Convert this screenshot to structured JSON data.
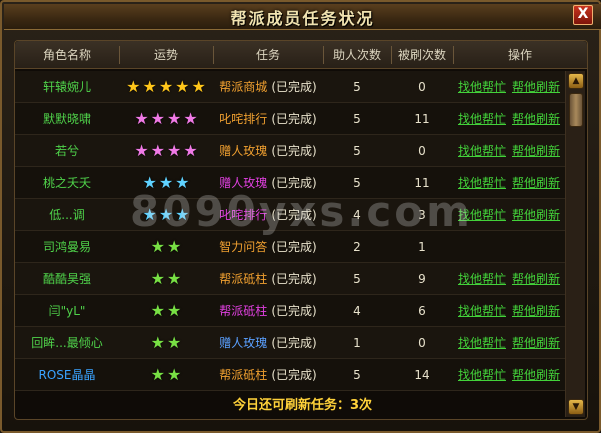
{
  "window": {
    "title": "帮派成员任务状况",
    "close_label": "X"
  },
  "table": {
    "headers": [
      "角色名称",
      "运势",
      "任务",
      "助人次数",
      "被刷次数",
      "操作"
    ],
    "rows": [
      {
        "name": "轩辕婉儿",
        "name_color": "green",
        "stars": 5,
        "star_color": "gold",
        "task": "帮派商城",
        "task_color": "#f0a030",
        "status": "(已完成)",
        "helped": "5",
        "refreshed": "0",
        "actions": [
          "找他帮忙",
          "帮他刷新"
        ]
      },
      {
        "name": "默默晓啸",
        "name_color": "green",
        "stars": 4,
        "star_color": "pink",
        "task": "叱咤排行",
        "task_color": "#f0a030",
        "status": "(已完成)",
        "helped": "5",
        "refreshed": "11",
        "actions": [
          "找他帮忙",
          "帮他刷新"
        ]
      },
      {
        "name": "若兮",
        "name_color": "green",
        "stars": 4,
        "star_color": "pink",
        "task": "赠人玫瑰",
        "task_color": "#f0a030",
        "status": "(已完成)",
        "helped": "5",
        "refreshed": "0",
        "actions": [
          "找他帮忙",
          "帮他刷新"
        ]
      },
      {
        "name": "桃之夭夭",
        "name_color": "green",
        "stars": 3,
        "star_color": "cyan",
        "task": "赠人玫瑰",
        "task_color": "#e040e0",
        "status": "(已完成)",
        "helped": "5",
        "refreshed": "11",
        "actions": [
          "找他帮忙",
          "帮他刷新"
        ]
      },
      {
        "name": "低...调",
        "name_color": "green",
        "stars": 3,
        "star_color": "cyan",
        "task": "叱咤排行",
        "task_color": "#e040e0",
        "status": "(已完成)",
        "helped": "4",
        "refreshed": "3",
        "actions": [
          "找他帮忙",
          "帮他刷新"
        ]
      },
      {
        "name": "司鸿曼易",
        "name_color": "green",
        "stars": 2,
        "star_color": "green",
        "task": "智力问答",
        "task_color": "#f0a030",
        "status": "(已完成)",
        "helped": "2",
        "refreshed": "1",
        "actions": []
      },
      {
        "name": "酷酷昊强",
        "name_color": "green",
        "stars": 2,
        "star_color": "green",
        "task": "帮派砥柱",
        "task_color": "#f0a030",
        "status": "(已完成)",
        "helped": "5",
        "refreshed": "9",
        "actions": [
          "找他帮忙",
          "帮他刷新"
        ]
      },
      {
        "name": "闫\"yL\"",
        "name_color": "green",
        "stars": 2,
        "star_color": "green",
        "task": "帮派砥柱",
        "task_color": "#e040e0",
        "status": "(已完成)",
        "helped": "4",
        "refreshed": "6",
        "actions": [
          "找他帮忙",
          "帮他刷新"
        ]
      },
      {
        "name": "回眸...最倾心",
        "name_color": "green",
        "stars": 2,
        "star_color": "green",
        "task": "赠人玫瑰",
        "task_color": "#5aa0ff",
        "status": "(已完成)",
        "helped": "1",
        "refreshed": "0",
        "actions": [
          "找他帮忙",
          "帮他刷新"
        ]
      },
      {
        "name": "ROSE晶晶",
        "name_color": "blue",
        "stars": 2,
        "star_color": "green",
        "task": "帮派砥柱",
        "task_color": "#f0a030",
        "status": "(已完成)",
        "helped": "5",
        "refreshed": "14",
        "actions": [
          "找他帮忙",
          "帮他刷新"
        ]
      }
    ]
  },
  "footer": {
    "text": "今日还可刷新任务：3次"
  },
  "watermark": "8090yxs.com",
  "scroll": {
    "up_icon": "▲",
    "down_icon": "▼"
  }
}
